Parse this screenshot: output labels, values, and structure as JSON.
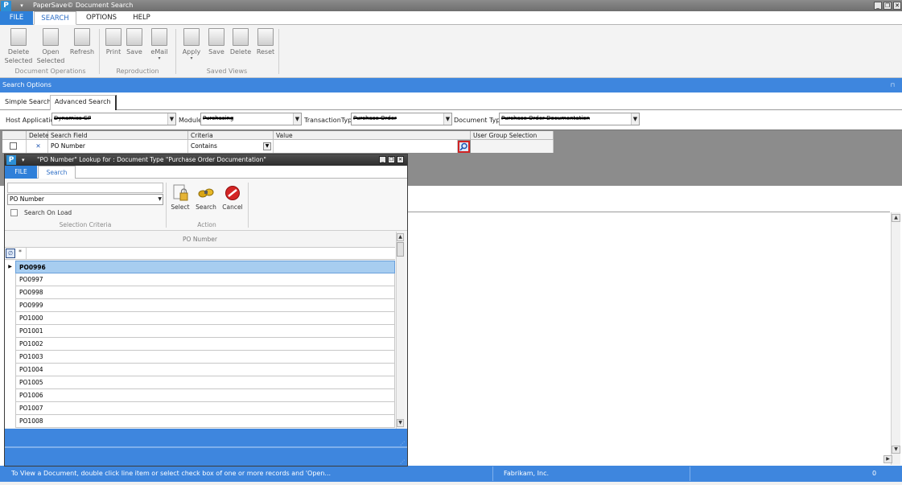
{
  "window": {
    "title": "PaperSave© Document Search",
    "app_icon": "P",
    "qat_icon": "quick-access-dropdown-icon",
    "minimize": "_",
    "restore": "❐",
    "close": "✕"
  },
  "menu": {
    "file": "FILE",
    "search": "SEARCH",
    "options": "OPTIONS",
    "help": "HELP"
  },
  "ribbon": {
    "delete_selected_1": "Delete",
    "delete_selected_2": "Selected",
    "open_selected_1": "Open",
    "open_selected_2": "Selected",
    "refresh": "Refresh",
    "print": "Print",
    "save_repro": "Save",
    "email": "eMail",
    "apply": "Apply",
    "save_view": "Save",
    "delete_view": "Delete",
    "reset": "Reset",
    "group_document_operations": "Document Operations",
    "group_reproduction": "Reproduction",
    "group_saved_views": "Saved Views"
  },
  "search_options": {
    "header": "Search Options",
    "tab_simple": "Simple Search",
    "tab_advanced": "Advanced Search",
    "host_application_label": "Host Application",
    "host_application_value": "Dynamics GP",
    "module_label": "Module",
    "module_value": "Purchasing",
    "transaction_type_label": "TransactionType",
    "transaction_type_value": "Purchase Order",
    "document_type_label": "Document Type",
    "document_type_value": "Purchase Order Documentation"
  },
  "criteria_grid": {
    "columns": {
      "delete": "Delete",
      "search_field": "Search Field",
      "criteria": "Criteria",
      "value": "Value",
      "user_group_selection": "User Group Selection"
    },
    "row": {
      "delete_icon": "✕",
      "search_field": "PO Number",
      "criteria": "Contains",
      "value": ""
    }
  },
  "status_bar": {
    "message": "To View a Document, double click line item or select check box of one or more records and 'Open...",
    "company": "Fabrikam, Inc.",
    "count": "0"
  },
  "lookup_dialog": {
    "title": "\"PO Number\" Lookup for : Document Type \"Purchase Order Documentation\"",
    "tab_file": "FILE",
    "tab_search": "Search",
    "search_text": "",
    "field_select": "PO Number",
    "search_on_load": "Search On Load",
    "group_selection_criteria": "Selection Criteria",
    "select": "Select",
    "search": "Search",
    "cancel": "Cancel",
    "group_action": "Action",
    "column_header": "PO Number",
    "filter_star": "*",
    "rows": [
      "PO0996",
      "PO0997",
      "PO0998",
      "PO0999",
      "PO1000",
      "PO1001",
      "PO1002",
      "PO1003",
      "PO1004",
      "PO1005",
      "PO1006",
      "PO1007",
      "PO1008"
    ],
    "selected_row": "PO0996"
  },
  "colors": {
    "accent_blue": "#3e86de",
    "file_tab": "#2f80d9",
    "selected_row": "#a7cdf0",
    "lookup_highlight": "#d02323"
  }
}
